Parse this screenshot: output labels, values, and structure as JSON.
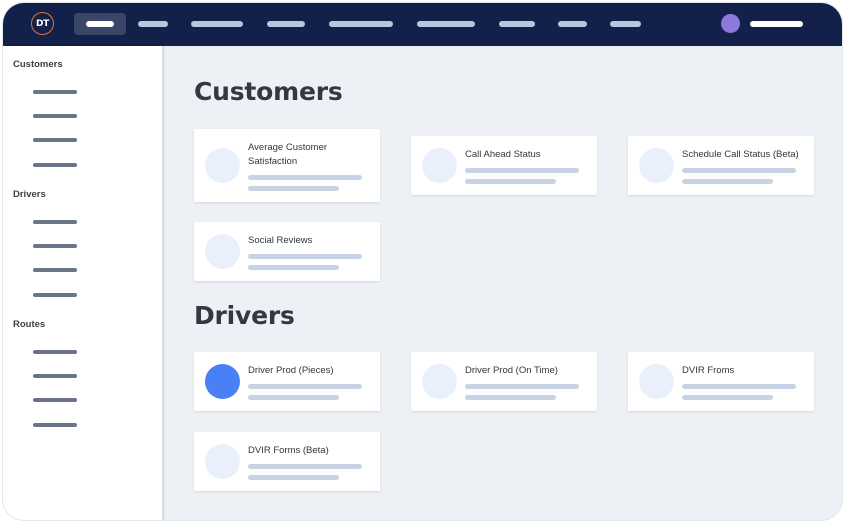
{
  "topbar": {
    "logo_text": "DT",
    "nav_items": [
      {
        "label": "",
        "active": true
      },
      {
        "label": "",
        "active": false
      },
      {
        "label": "",
        "active": false
      },
      {
        "label": "",
        "active": false
      },
      {
        "label": "",
        "active": false
      },
      {
        "label": "",
        "active": false
      },
      {
        "label": "",
        "active": false
      },
      {
        "label": "",
        "active": false
      },
      {
        "label": "",
        "active": false
      }
    ],
    "user_avatar_color": "#8c79dc",
    "user_name": ""
  },
  "sidebar": {
    "sections": [
      {
        "title": "Customers",
        "links": 4
      },
      {
        "title": "Drivers",
        "links": 4
      },
      {
        "title": "Routes",
        "links": 4
      }
    ]
  },
  "main": {
    "sections": [
      {
        "title": "Customers",
        "cards": [
          {
            "label": "Average Customer Satisfaction",
            "selected": false
          },
          {
            "label": "Call Ahead Status",
            "selected": false
          },
          {
            "label": "Schedule Call Status (Beta)",
            "selected": false
          },
          {
            "label": "Social Reviews",
            "selected": false
          }
        ]
      },
      {
        "title": "Drivers",
        "cards": [
          {
            "label": "Driver Prod (Pieces)",
            "selected": true
          },
          {
            "label": "Driver Prod (On Time)",
            "selected": false
          },
          {
            "label": "DVIR Froms",
            "selected": false
          },
          {
            "label": "DVIR Forms (Beta)",
            "selected": false
          }
        ]
      }
    ]
  },
  "colors": {
    "topbar_bg": "#13204a",
    "accent_blue": "#4a80f5",
    "logo_ring": "#d9743c",
    "page_bg": "#edf0f4"
  }
}
